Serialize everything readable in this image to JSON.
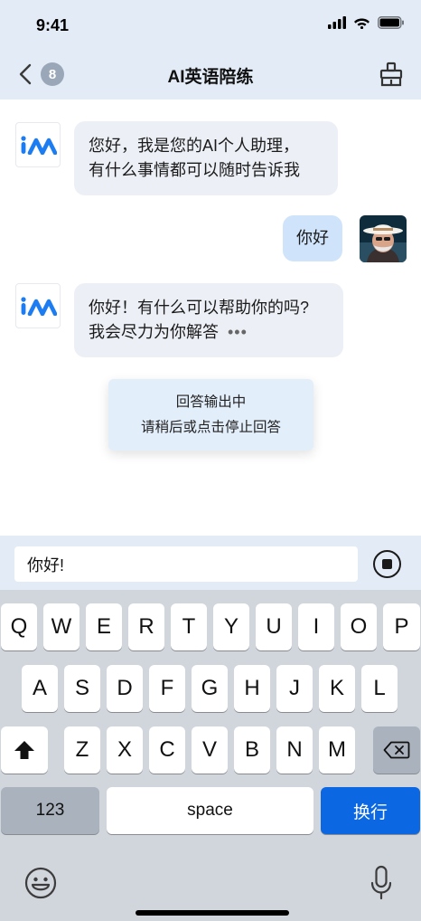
{
  "status": {
    "time": "9:41"
  },
  "nav": {
    "badge": "8",
    "title": "AI英语陪练"
  },
  "messages": [
    {
      "sender": "bot",
      "lines": [
        "您好，我是您的AI个人助理，",
        "有什么事情都可以随时告诉我"
      ]
    },
    {
      "sender": "user",
      "text": "你好"
    },
    {
      "sender": "bot",
      "lines": [
        "你好！有什么可以帮助你的吗?",
        "我会尽力为你解答"
      ],
      "typing": "•••"
    }
  ],
  "toast": {
    "line1": "回答输出中",
    "line2": "请稍后或点击停止回答"
  },
  "input": {
    "value": "你好!"
  },
  "keyboard": {
    "row1": [
      "Q",
      "W",
      "E",
      "R",
      "T",
      "Y",
      "U",
      "I",
      "O",
      "P"
    ],
    "row2": [
      "A",
      "S",
      "D",
      "F",
      "G",
      "H",
      "J",
      "K",
      "L"
    ],
    "row3": [
      "Z",
      "X",
      "C",
      "V",
      "B",
      "N",
      "M"
    ],
    "numbers_label": "123",
    "space_label": "space",
    "return_label": "换行"
  },
  "icons": {
    "back": "chevron-left-icon",
    "clean": "broom-icon",
    "stop": "stop-icon",
    "shift": "shift-icon",
    "delete": "delete-icon",
    "emoji": "emoji-icon",
    "mic": "microphone-icon"
  },
  "colors": {
    "accent": "#0b68e2",
    "user_bubble": "#cfe3fb",
    "bot_bubble": "#eceff5",
    "header_bg": "#e3ecf6",
    "keyboard_bg": "#d1d6dd"
  }
}
